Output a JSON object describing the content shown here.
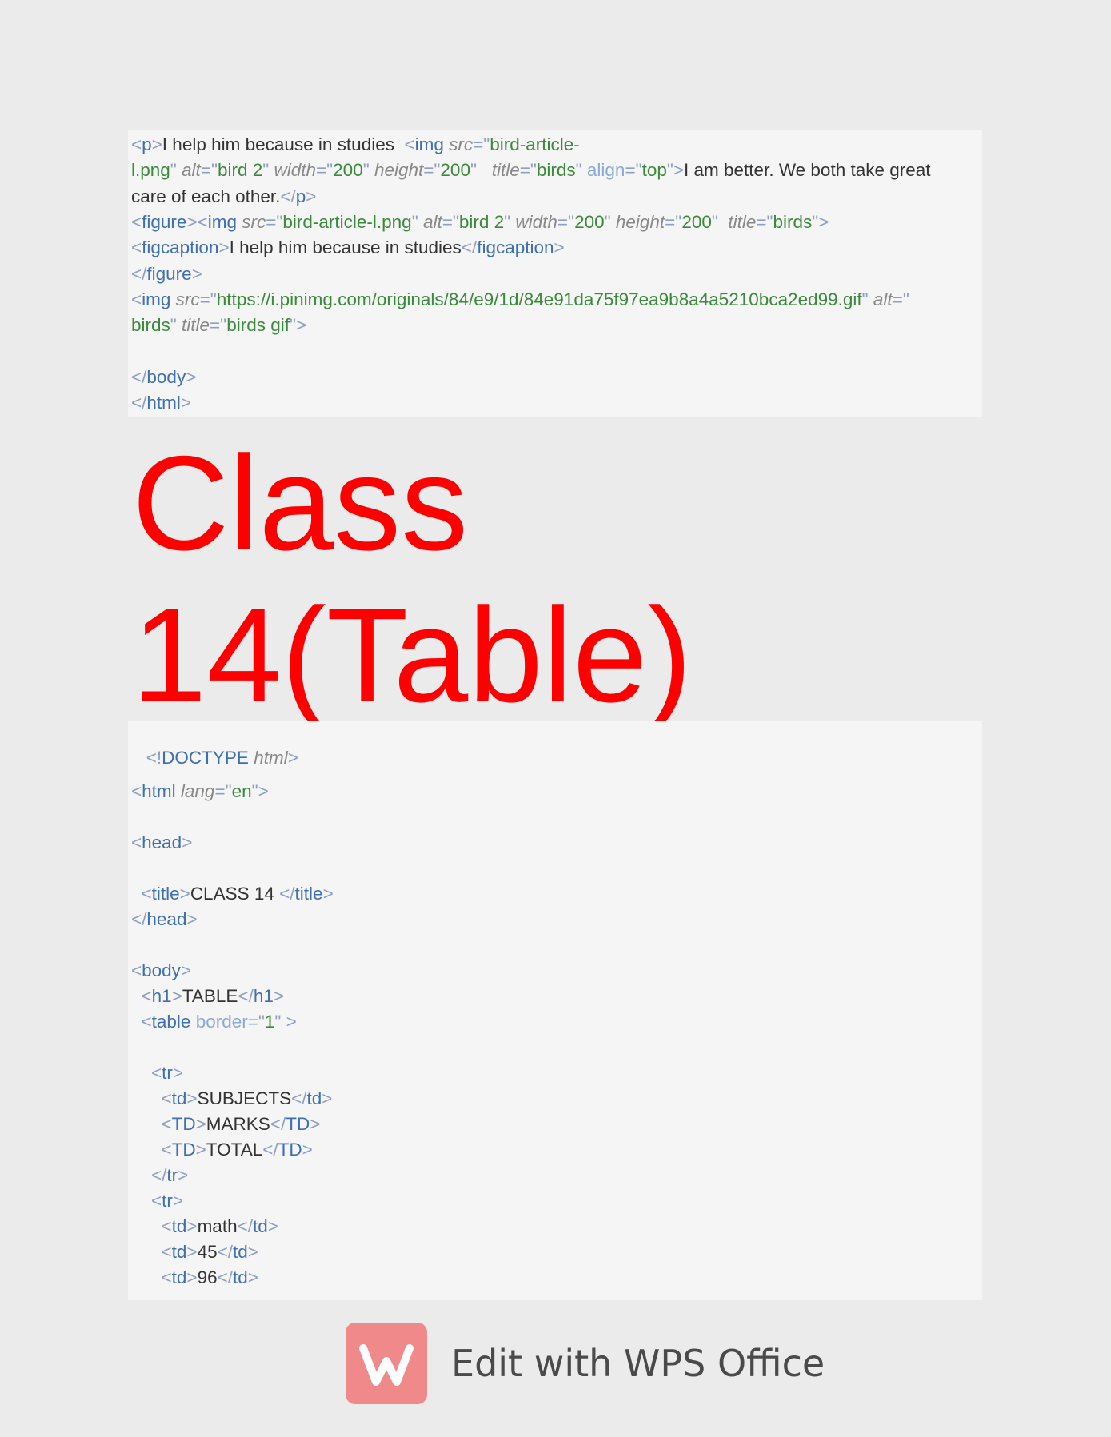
{
  "code_top": {
    "lines": [
      {
        "parts": [
          [
            "br",
            "<"
          ],
          [
            "tg",
            "p"
          ],
          [
            "br",
            ">"
          ],
          [
            "tx",
            "I help him because in studies  "
          ],
          [
            "br",
            "<"
          ],
          [
            "tg",
            "img "
          ],
          [
            "at",
            "src"
          ],
          [
            "br",
            "=\""
          ],
          [
            "vl",
            "bird-article-"
          ]
        ]
      },
      {
        "parts": [
          [
            "vl",
            "l.png"
          ],
          [
            "br",
            "\" "
          ],
          [
            "at",
            "alt"
          ],
          [
            "br",
            "=\""
          ],
          [
            "vl",
            "bird 2"
          ],
          [
            "br",
            "\" "
          ],
          [
            "at",
            "width"
          ],
          [
            "br",
            "=\""
          ],
          [
            "vl",
            "200"
          ],
          [
            "br",
            "\" "
          ],
          [
            "at",
            "height"
          ],
          [
            "br",
            "=\""
          ],
          [
            "vl",
            "200"
          ],
          [
            "br",
            "\"   "
          ],
          [
            "at",
            "title"
          ],
          [
            "br",
            "=\""
          ],
          [
            "vl",
            "birds"
          ],
          [
            "br",
            "\" "
          ],
          [
            "ak",
            "align"
          ],
          [
            "br",
            "=\""
          ],
          [
            "vl",
            "top"
          ],
          [
            "br",
            "\">"
          ],
          [
            "tx",
            "I am better. We both take great"
          ]
        ]
      },
      {
        "parts": [
          [
            "tx",
            "care of each other."
          ],
          [
            "br",
            "</"
          ],
          [
            "tg",
            "p"
          ],
          [
            "br",
            ">"
          ]
        ]
      },
      {
        "parts": [
          [
            "br",
            "<"
          ],
          [
            "tg",
            "figure"
          ],
          [
            "br",
            "><"
          ],
          [
            "tg",
            "img "
          ],
          [
            "at",
            "src"
          ],
          [
            "br",
            "=\""
          ],
          [
            "vl",
            "bird-article-l.png"
          ],
          [
            "br",
            "\" "
          ],
          [
            "at",
            "alt"
          ],
          [
            "br",
            "=\""
          ],
          [
            "vl",
            "bird 2"
          ],
          [
            "br",
            "\" "
          ],
          [
            "at",
            "width"
          ],
          [
            "br",
            "=\""
          ],
          [
            "vl",
            "200"
          ],
          [
            "br",
            "\" "
          ],
          [
            "at",
            "height"
          ],
          [
            "br",
            "=\""
          ],
          [
            "vl",
            "200"
          ],
          [
            "br",
            "\"  "
          ],
          [
            "at",
            "title"
          ],
          [
            "br",
            "=\""
          ],
          [
            "vl",
            "birds"
          ],
          [
            "br",
            "\">"
          ]
        ]
      },
      {
        "parts": [
          [
            "br",
            "<"
          ],
          [
            "tg",
            "figcaption"
          ],
          [
            "br",
            ">"
          ],
          [
            "tx",
            "I help him because in studies"
          ],
          [
            "br",
            "</"
          ],
          [
            "tg",
            "figcaption"
          ],
          [
            "br",
            ">"
          ]
        ]
      },
      {
        "parts": [
          [
            "br",
            "</"
          ],
          [
            "tg",
            "figure"
          ],
          [
            "br",
            ">"
          ]
        ]
      },
      {
        "parts": [
          [
            "br",
            "<"
          ],
          [
            "tg",
            "img "
          ],
          [
            "at",
            "src"
          ],
          [
            "br",
            "=\""
          ],
          [
            "vl",
            "https://i.pinimg.com/originals/84/e9/1d/84e91da75f97ea9b8a4a5210bca2ed99.gif"
          ],
          [
            "br",
            "\" "
          ],
          [
            "at",
            "alt"
          ],
          [
            "br",
            "=\""
          ]
        ]
      },
      {
        "parts": [
          [
            "vl",
            "birds"
          ],
          [
            "br",
            "\" "
          ],
          [
            "at",
            "title"
          ],
          [
            "br",
            "=\""
          ],
          [
            "vl",
            "birds gif"
          ],
          [
            "br",
            "\">"
          ]
        ]
      },
      {
        "parts": []
      },
      {
        "parts": [
          [
            "br",
            "</"
          ],
          [
            "tg",
            "body"
          ],
          [
            "br",
            ">"
          ]
        ]
      },
      {
        "parts": [
          [
            "br",
            "</"
          ],
          [
            "tg",
            "html"
          ],
          [
            "br",
            ">"
          ]
        ]
      }
    ]
  },
  "heading": {
    "line1": "Class",
    "line2": "14(Table)",
    "color": "#ff0000"
  },
  "code_bottom": {
    "lines": [
      {
        "parts": [
          [
            "tx",
            "   "
          ],
          [
            "br",
            "<!"
          ],
          [
            "tg",
            "DOCTYPE "
          ],
          [
            "at",
            "html"
          ],
          [
            "br",
            ">"
          ]
        ]
      },
      {
        "parts": [
          [
            "br",
            "<"
          ],
          [
            "tg",
            "html "
          ],
          [
            "at",
            "lang"
          ],
          [
            "br",
            "=\""
          ],
          [
            "vl",
            "en"
          ],
          [
            "br",
            "\">"
          ]
        ]
      },
      {
        "parts": []
      },
      {
        "parts": [
          [
            "br",
            "<"
          ],
          [
            "tg",
            "head"
          ],
          [
            "br",
            ">"
          ]
        ]
      },
      {
        "parts": []
      },
      {
        "parts": [
          [
            "tx",
            "  "
          ],
          [
            "br",
            "<"
          ],
          [
            "tg",
            "title"
          ],
          [
            "br",
            ">"
          ],
          [
            "tx",
            "CLASS 14 "
          ],
          [
            "br",
            "</"
          ],
          [
            "tg",
            "title"
          ],
          [
            "br",
            ">"
          ]
        ]
      },
      {
        "parts": [
          [
            "br",
            "</"
          ],
          [
            "tg",
            "head"
          ],
          [
            "br",
            ">"
          ]
        ]
      },
      {
        "parts": []
      },
      {
        "parts": [
          [
            "br",
            "<"
          ],
          [
            "tg",
            "body"
          ],
          [
            "br",
            ">"
          ]
        ]
      },
      {
        "parts": [
          [
            "tx",
            "  "
          ],
          [
            "br",
            "<"
          ],
          [
            "tg",
            "h1"
          ],
          [
            "br",
            ">"
          ],
          [
            "tx",
            "TABLE"
          ],
          [
            "br",
            "</"
          ],
          [
            "tg",
            "h1"
          ],
          [
            "br",
            ">"
          ]
        ]
      },
      {
        "parts": [
          [
            "tx",
            "  "
          ],
          [
            "br",
            "<"
          ],
          [
            "tg",
            "table "
          ],
          [
            "ak",
            "border"
          ],
          [
            "br",
            "=\""
          ],
          [
            "vl",
            "1"
          ],
          [
            "br",
            "\" >"
          ]
        ]
      },
      {
        "parts": []
      },
      {
        "parts": [
          [
            "tx",
            "    "
          ],
          [
            "br",
            "<"
          ],
          [
            "tg",
            "tr"
          ],
          [
            "br",
            ">"
          ]
        ]
      },
      {
        "parts": [
          [
            "tx",
            "      "
          ],
          [
            "br",
            "<"
          ],
          [
            "tg",
            "td"
          ],
          [
            "br",
            ">"
          ],
          [
            "tx",
            "SUBJECTS"
          ],
          [
            "br",
            "</"
          ],
          [
            "tg",
            "td"
          ],
          [
            "br",
            ">"
          ]
        ]
      },
      {
        "parts": [
          [
            "tx",
            "      "
          ],
          [
            "br",
            "<"
          ],
          [
            "tg",
            "TD"
          ],
          [
            "br",
            ">"
          ],
          [
            "tx",
            "MARKS"
          ],
          [
            "br",
            "</"
          ],
          [
            "tg",
            "TD"
          ],
          [
            "br",
            ">"
          ]
        ]
      },
      {
        "parts": [
          [
            "tx",
            "      "
          ],
          [
            "br",
            "<"
          ],
          [
            "tg",
            "TD"
          ],
          [
            "br",
            ">"
          ],
          [
            "tx",
            "TOTAL"
          ],
          [
            "br",
            "</"
          ],
          [
            "tg",
            "TD"
          ],
          [
            "br",
            ">"
          ]
        ]
      },
      {
        "parts": [
          [
            "tx",
            "    "
          ],
          [
            "br",
            "</"
          ],
          [
            "tg",
            "tr"
          ],
          [
            "br",
            ">"
          ]
        ]
      },
      {
        "parts": [
          [
            "tx",
            "    "
          ],
          [
            "br",
            "<"
          ],
          [
            "tg",
            "tr"
          ],
          [
            "br",
            ">"
          ]
        ]
      },
      {
        "parts": [
          [
            "tx",
            "      "
          ],
          [
            "br",
            "<"
          ],
          [
            "tg",
            "td"
          ],
          [
            "br",
            ">"
          ],
          [
            "tx",
            "math"
          ],
          [
            "br",
            "</"
          ],
          [
            "tg",
            "td"
          ],
          [
            "br",
            ">"
          ]
        ]
      },
      {
        "parts": [
          [
            "tx",
            "      "
          ],
          [
            "br",
            "<"
          ],
          [
            "tg",
            "td"
          ],
          [
            "br",
            ">"
          ],
          [
            "tx",
            "45"
          ],
          [
            "br",
            "</"
          ],
          [
            "tg",
            "td"
          ],
          [
            "br",
            ">"
          ]
        ]
      },
      {
        "parts": [
          [
            "tx",
            "      "
          ],
          [
            "br",
            "<"
          ],
          [
            "tg",
            "td"
          ],
          [
            "br",
            ">"
          ],
          [
            "tx",
            "96"
          ],
          [
            "br",
            "</"
          ],
          [
            "tg",
            "td"
          ],
          [
            "br",
            ">"
          ]
        ]
      }
    ]
  },
  "footer": {
    "label": "Edit with WPS Office",
    "logo_icon": "wps-office-logo-icon",
    "logo_color": "#f08a8a"
  }
}
